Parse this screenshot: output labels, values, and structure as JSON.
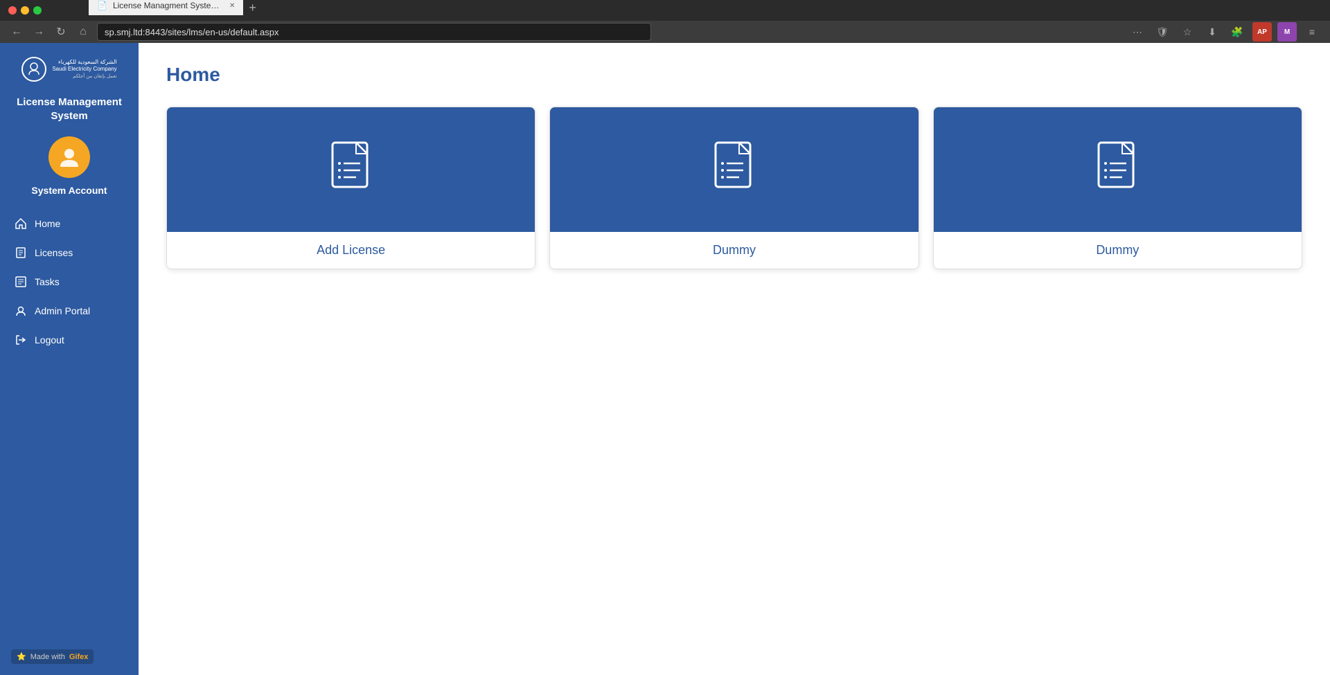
{
  "browser": {
    "tab_title": "License Managment System | Man...",
    "url": "sp.smj.ltd:8443/sites/lms/en-us/default.aspx",
    "favicon": "📄"
  },
  "sidebar": {
    "logo_text_line1": "الشركة السعودية للكهرباء",
    "logo_text_line2": "Saudi Electricity Company",
    "logo_text_line3": "تعمل بإتقان من أجلكم",
    "system_title": "License Management System",
    "user_name": "System Account",
    "nav_items": [
      {
        "id": "home",
        "label": "Home",
        "icon": "home"
      },
      {
        "id": "licenses",
        "label": "Licenses",
        "icon": "list"
      },
      {
        "id": "tasks",
        "label": "Tasks",
        "icon": "tasks"
      },
      {
        "id": "admin",
        "label": "Admin Portal",
        "icon": "admin"
      },
      {
        "id": "logout",
        "label": "Logout",
        "icon": "logout"
      }
    ],
    "footer_made_with": "Made with",
    "footer_brand": "Gifex"
  },
  "main": {
    "page_title": "Home",
    "cards": [
      {
        "id": "add-license",
        "label": "Add License"
      },
      {
        "id": "dummy-1",
        "label": "Dummy"
      },
      {
        "id": "dummy-2",
        "label": "Dummy"
      }
    ]
  }
}
